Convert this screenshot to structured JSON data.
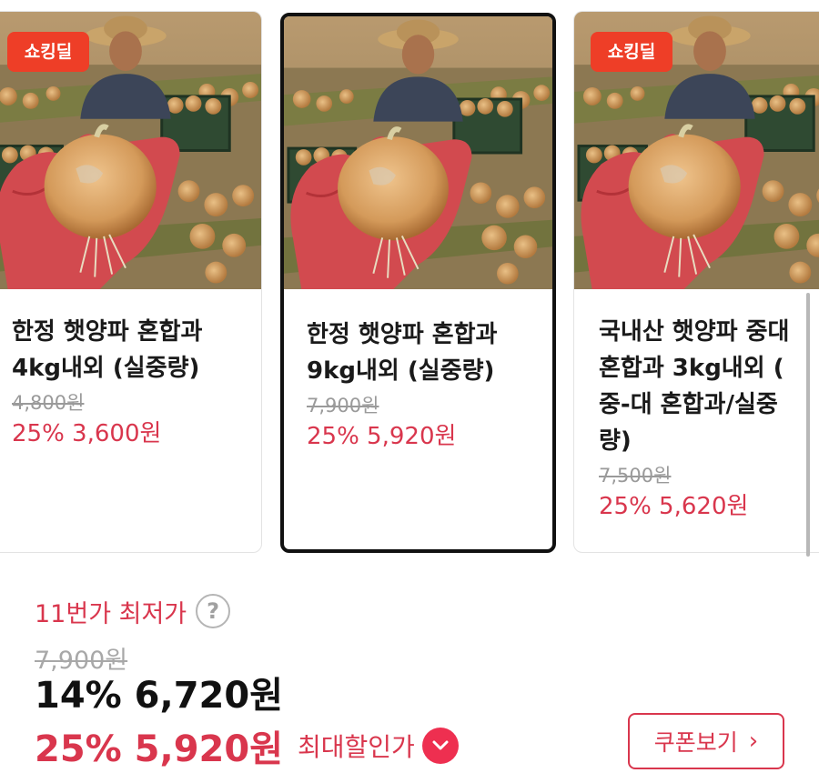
{
  "carousel": {
    "cards": [
      {
        "badge": "쇼킹딜",
        "title": "한정 햇양파 혼합과\n4kg내외 (실중량)",
        "original_price": "4,800원",
        "sale": "25% 3,600원"
      },
      {
        "badge": "",
        "title": "한정 햇양파 혼합과\n9kg내외 (실중량)",
        "original_price": "7,900원",
        "sale": "25% 5,920원"
      },
      {
        "badge": "쇼킹딜",
        "title": "국내산 햇양파 중대\n혼합과 3kg내외 (\n중-대 혼합과/실중\n량)",
        "original_price": "7,500원",
        "sale": "25% 5,620원"
      }
    ]
  },
  "price": {
    "lowest_label": "11번가 최저가",
    "help_icon": "?",
    "original_price": "7,900원",
    "first_discount": "14% 6,720원",
    "max_discount_price": "25% 5,920원",
    "max_discount_label": "최대할인가",
    "coupon_button": "쿠폰보기",
    "coupon_chevron": "›"
  },
  "colors": {
    "accent": "#d9364d",
    "badge": "#ee3e27",
    "selected_border": "#111111"
  },
  "icons": {
    "help": "question-circle-icon",
    "expand": "chevron-down-circle-icon",
    "coupon": "chevron-right-icon"
  }
}
